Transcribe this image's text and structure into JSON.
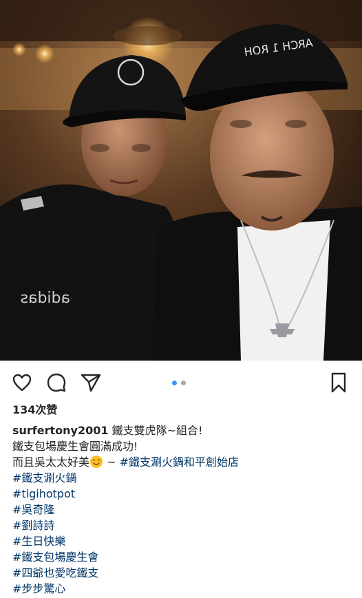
{
  "post": {
    "likes": "134次赞",
    "username": "surfertony2001",
    "caption_first": " 鐵支雙虎隊~組合!",
    "caption_line2": "鐵支包場慶生會圓滿成功!",
    "caption_line3_prefix": "而且吳太太好美",
    "caption_line3_mid": " ~ ",
    "caption_line3_tag": "#鐵支涮火鍋和平創始店",
    "hashtags": [
      "#鐵支涮火鍋",
      "#tigihotpot",
      "#吳奇隆",
      "#劉詩詩",
      "#生日快樂",
      "#鐵支包場慶生會",
      "#四爺也愛吃鐵支",
      "#步步驚心"
    ],
    "carousel": {
      "total": 2,
      "active": 1
    }
  },
  "icons": {
    "like": "heart-icon",
    "comment": "comment-icon",
    "share": "paper-plane-icon",
    "save": "bookmark-icon",
    "emoji": "smiling-face-emoji"
  },
  "colors": {
    "hashtag": "#003569",
    "active_dot": "#3897f0",
    "inactive_dot": "#a8a8a8",
    "text": "#262626"
  },
  "photo": {
    "cap_left_text": "adidas",
    "cap_right_text": "ARCH 1 ROH"
  }
}
